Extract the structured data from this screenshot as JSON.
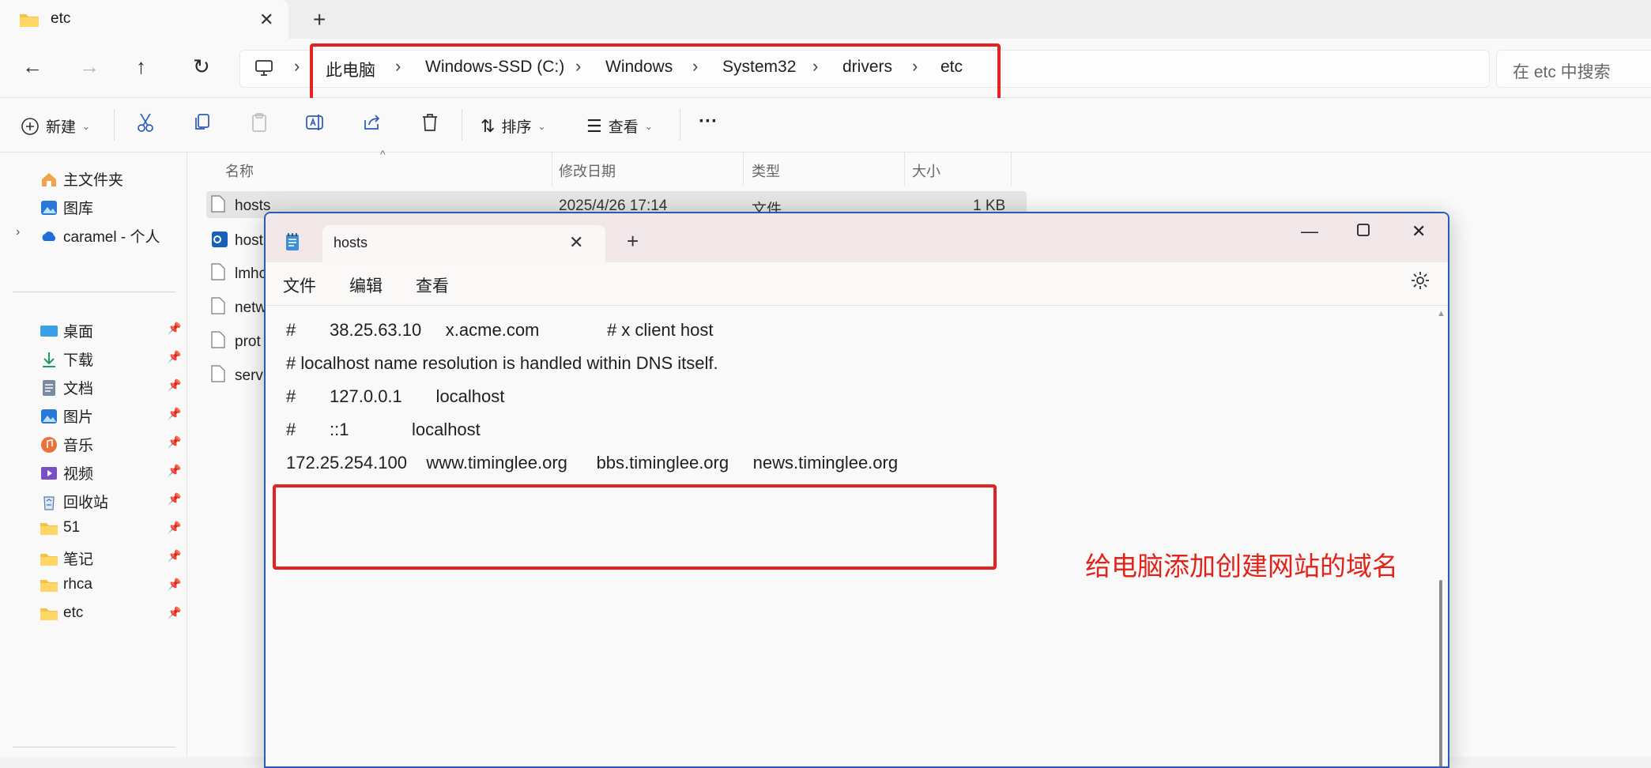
{
  "explorer": {
    "tab_title": "etc",
    "breadcrumb": [
      "此电脑",
      "Windows-SSD (C:)",
      "Windows",
      "System32",
      "drivers",
      "etc"
    ],
    "search_placeholder": "在 etc 中搜索",
    "commands": {
      "new": "新建",
      "sort": "排序",
      "view": "查看",
      "more": "···"
    },
    "sidebar": {
      "top": [
        {
          "label": "主文件夹",
          "icon": "home-icon"
        },
        {
          "label": "图库",
          "icon": "gallery-icon"
        },
        {
          "label": "caramel - 个人",
          "icon": "cloud-icon"
        }
      ],
      "pinned": [
        {
          "label": "桌面",
          "icon": "desktop-icon"
        },
        {
          "label": "下载",
          "icon": "download-icon"
        },
        {
          "label": "文档",
          "icon": "document-icon"
        },
        {
          "label": "图片",
          "icon": "pictures-icon"
        },
        {
          "label": "音乐",
          "icon": "music-icon"
        },
        {
          "label": "视频",
          "icon": "video-icon"
        },
        {
          "label": "回收站",
          "icon": "recycle-bin-icon"
        },
        {
          "label": "51",
          "icon": "folder-icon"
        },
        {
          "label": "笔记",
          "icon": "folder-icon"
        },
        {
          "label": "rhca",
          "icon": "folder-icon"
        },
        {
          "label": "etc",
          "icon": "folder-icon"
        }
      ]
    },
    "columns": [
      "名称",
      "修改日期",
      "类型",
      "大小"
    ],
    "files": [
      {
        "name": "hosts",
        "date": "2025/4/26 17:14",
        "type": "文件",
        "size": "1 KB"
      },
      {
        "name": "host",
        "date": "",
        "type": "",
        "size": ""
      },
      {
        "name": "lmhc",
        "date": "",
        "type": "",
        "size": ""
      },
      {
        "name": "netw",
        "date": "",
        "type": "",
        "size": ""
      },
      {
        "name": "prot",
        "date": "",
        "type": "",
        "size": ""
      },
      {
        "name": "servi",
        "date": "",
        "type": "",
        "size": ""
      }
    ]
  },
  "notepad": {
    "tab_title": "hosts",
    "menu": [
      "文件",
      "编辑",
      "查看"
    ],
    "lines": [
      "#       38.25.63.10     x.acme.com              # x client host",
      "# localhost name resolution is handled within DNS itself.",
      "#       127.0.0.1       localhost",
      "#       ::1             localhost",
      "172.25.254.100    www.timinglee.org      bbs.timinglee.org     news.timinglee.org"
    ]
  },
  "annotation": "给电脑添加创建网站的域名",
  "colors": {
    "highlight_red": "#e32222",
    "annotation_red": "#e2231a",
    "notepad_border": "#2a5ab8"
  }
}
